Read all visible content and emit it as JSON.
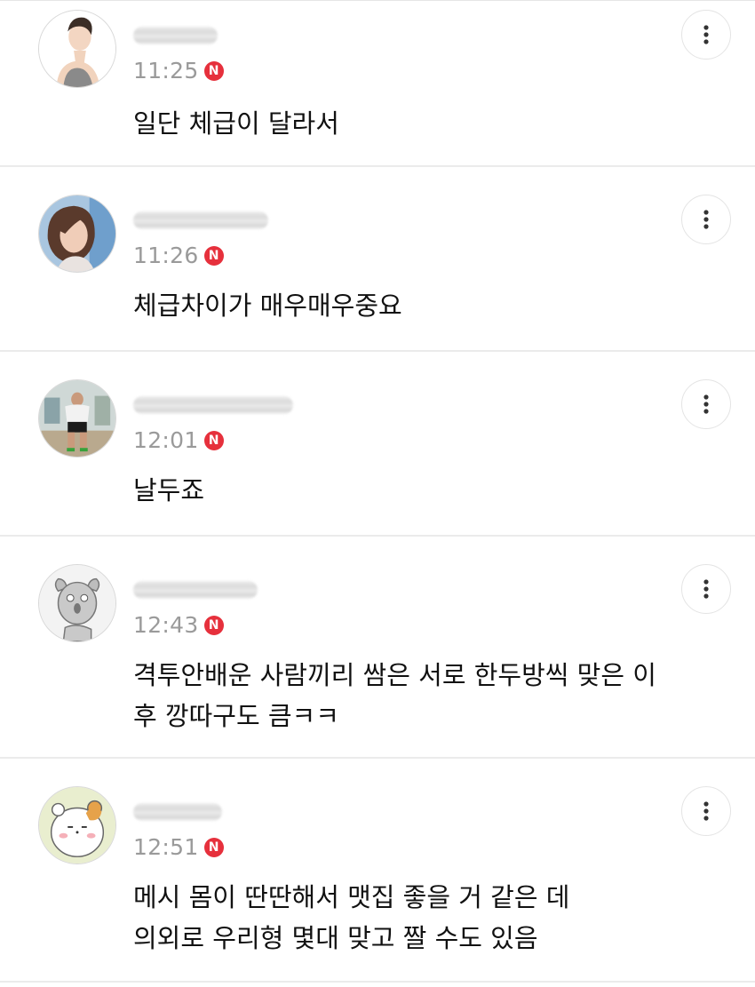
{
  "comments": [
    {
      "time": "11:25",
      "badge": "N",
      "text": "일단 체급이 달라서",
      "avatar": "woman-tanktop-avatar"
    },
    {
      "time": "11:26",
      "badge": "N",
      "text": "체급차이가 매우매우중요",
      "avatar": "woman-photo-avatar"
    },
    {
      "time": "12:01",
      "badge": "N",
      "text": "날두죠",
      "avatar": "bodybuilder-gym-avatar"
    },
    {
      "time": "12:43",
      "badge": "N",
      "text": "격투안배운 사람끼리 쌈은 서로 한두방씩 맞은 이\n후 깡따구도 큼ㅋㅋ",
      "avatar": "shocked-dog-avatar"
    },
    {
      "time": "12:51",
      "badge": "N",
      "text": "메시 몸이 딴딴해서 맷집 좋을 거 같은 데\n의외로 우리형 몇대 맞고 짤 수도 있음",
      "avatar": "hamster-avatar"
    }
  ],
  "colors": {
    "badge": "#e6303c",
    "time": "#9a9a9a",
    "divider": "#ebebeb"
  }
}
